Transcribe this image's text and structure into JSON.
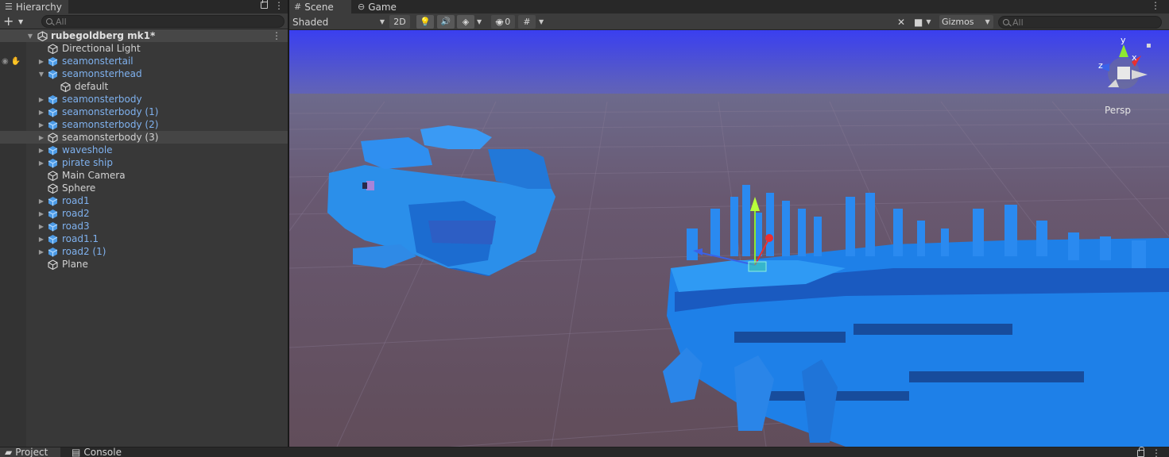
{
  "hierarchy": {
    "tab_title": "Hierarchy",
    "add_label": "+",
    "search_placeholder": "All",
    "scene_name": "rubegoldberg mk1*",
    "items": [
      {
        "label": "Directional Light",
        "kind": "plain",
        "indent": 1,
        "arrow": ""
      },
      {
        "label": "seamonstertail",
        "kind": "prefab",
        "indent": 1,
        "arrow": "collapsed"
      },
      {
        "label": "seamonsterhead",
        "kind": "prefab",
        "indent": 1,
        "arrow": "expanded"
      },
      {
        "label": "default",
        "kind": "plain",
        "indent": 2,
        "arrow": ""
      },
      {
        "label": "seamonsterbody",
        "kind": "prefab",
        "indent": 1,
        "arrow": "collapsed"
      },
      {
        "label": "seamonsterbody (1)",
        "kind": "prefab",
        "indent": 1,
        "arrow": "collapsed"
      },
      {
        "label": "seamonsterbody (2)",
        "kind": "prefab",
        "indent": 1,
        "arrow": "collapsed"
      },
      {
        "label": "seamonsterbody (3)",
        "kind": "plain",
        "indent": 1,
        "arrow": "collapsed"
      },
      {
        "label": "waveshole",
        "kind": "prefab",
        "indent": 1,
        "arrow": "collapsed"
      },
      {
        "label": "pirate ship",
        "kind": "prefab",
        "indent": 1,
        "arrow": "collapsed"
      },
      {
        "label": "Main Camera",
        "kind": "plain",
        "indent": 1,
        "arrow": ""
      },
      {
        "label": "Sphere",
        "kind": "plain",
        "indent": 1,
        "arrow": ""
      },
      {
        "label": "road1",
        "kind": "prefab",
        "indent": 1,
        "arrow": "collapsed"
      },
      {
        "label": "road2",
        "kind": "prefab",
        "indent": 1,
        "arrow": "collapsed"
      },
      {
        "label": "road3",
        "kind": "prefab",
        "indent": 1,
        "arrow": "collapsed"
      },
      {
        "label": "road1.1",
        "kind": "prefab",
        "indent": 1,
        "arrow": "collapsed"
      },
      {
        "label": "road2 (1)",
        "kind": "prefab",
        "indent": 1,
        "arrow": "collapsed"
      },
      {
        "label": "Plane",
        "kind": "plain",
        "indent": 1,
        "arrow": ""
      }
    ]
  },
  "scene": {
    "tabs": [
      {
        "label": "Scene",
        "icon": "grid-icon"
      },
      {
        "label": "Game",
        "icon": "gamepad-icon"
      }
    ],
    "shading_mode": "Shaded",
    "toggle_2d": "2D",
    "hidden_count": "0",
    "gizmos_label": "Gizmos",
    "search_placeholder": "All",
    "projection_label": "Persp",
    "axis_labels": {
      "y": "y",
      "x": "x",
      "z": "z"
    }
  },
  "bottom_tabs": [
    {
      "label": "Project",
      "icon": "folder-icon"
    },
    {
      "label": "Console",
      "icon": "console-icon"
    }
  ],
  "colors": {
    "sky_top": "#3a3ff0",
    "ground": "#655368",
    "monster": "#1e84e8",
    "prefab_text": "#7fb1ee"
  }
}
